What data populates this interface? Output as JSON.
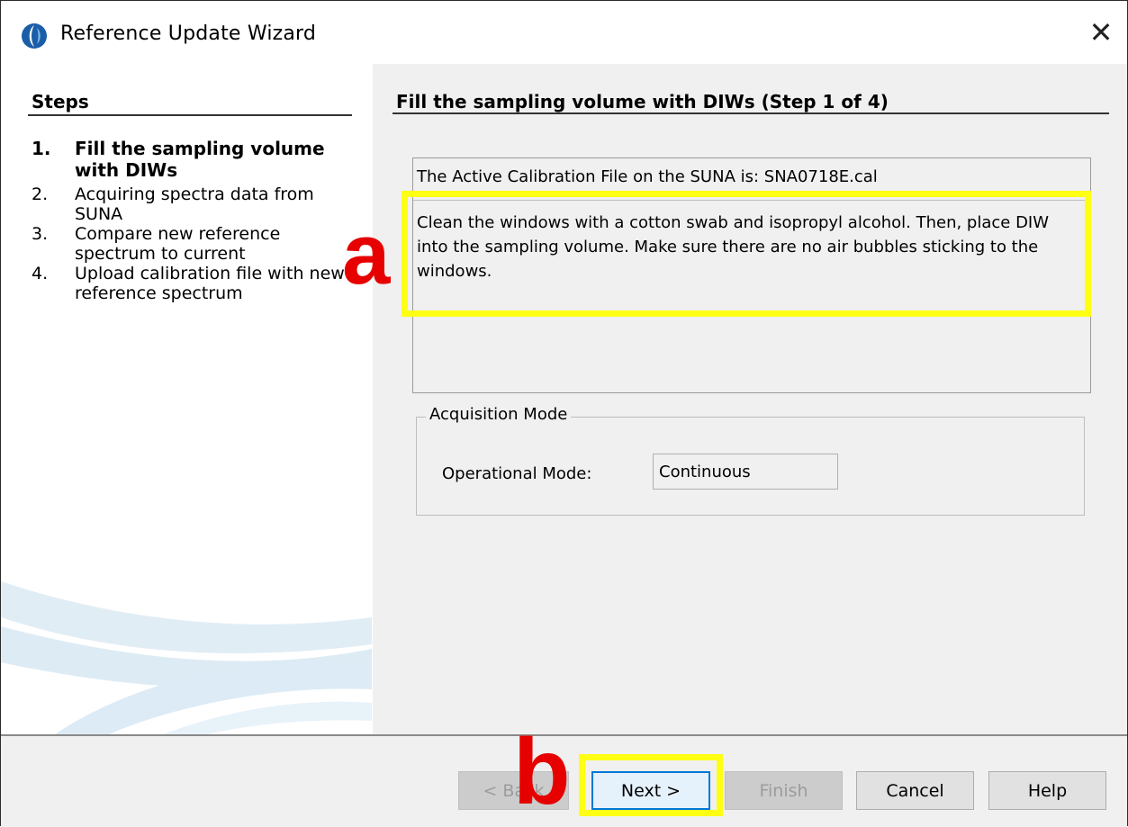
{
  "window": {
    "title": "Reference Update Wizard",
    "close_glyph": "✕"
  },
  "steps": {
    "header": "Steps",
    "items": [
      {
        "num": "1.",
        "label": "Fill the sampling volume with DIWs",
        "active": true
      },
      {
        "num": "2.",
        "label": "Acquiring spectra data from SUNA",
        "active": false
      },
      {
        "num": "3.",
        "label": "Compare new reference spectrum to current",
        "active": false
      },
      {
        "num": "4.",
        "label": "Upload calibration file with new reference spectrum",
        "active": false
      }
    ]
  },
  "content": {
    "header": "Fill the sampling volume with DIWs (Step 1 of 4)",
    "active_cal_text": "The Active Calibration File on the SUNA is: SNA0718E.cal",
    "instructions": "Clean the windows with a cotton swab and isopropyl alcohol. Then, place DIW into the sampling volume. Make sure there are no air bubbles sticking to the windows.",
    "acquisition": {
      "title": "Acquisition Mode",
      "op_mode_label": "Operational Mode:",
      "op_mode_value": "Continuous"
    }
  },
  "annotations": {
    "marker_a": "a",
    "marker_b": "b",
    "highlight_color": "#ffff14",
    "marker_color": "#e60000"
  },
  "footer": {
    "back": "< Back",
    "next": "Next >",
    "finish": "Finish",
    "cancel": "Cancel",
    "help": "Help"
  },
  "icons": {
    "app": "suna-logo-icon",
    "close": "close-icon"
  }
}
